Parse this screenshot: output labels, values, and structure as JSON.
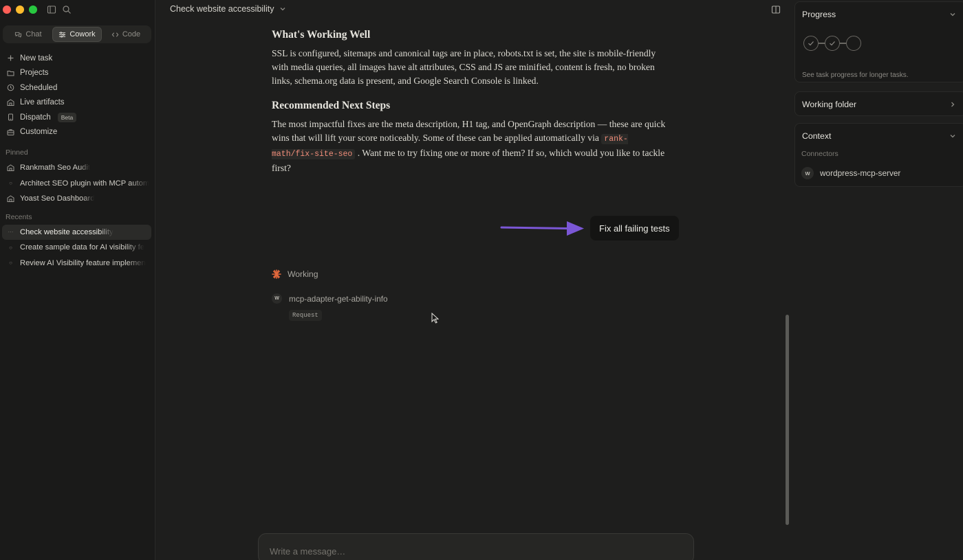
{
  "sidebar": {
    "mode_tabs": [
      {
        "label": "Chat",
        "icon": "chat-bubbles-icon"
      },
      {
        "label": "Cowork",
        "icon": "sliders-icon",
        "active": true
      },
      {
        "label": "Code",
        "icon": "code-brackets-icon"
      }
    ],
    "nav": [
      {
        "label": "New task",
        "icon": "plus-icon"
      },
      {
        "label": "Projects",
        "icon": "folder-icon"
      },
      {
        "label": "Scheduled",
        "icon": "clock-icon"
      },
      {
        "label": "Live artifacts",
        "icon": "artifact-icon"
      },
      {
        "label": "Dispatch",
        "icon": "phone-icon",
        "badge": "Beta"
      },
      {
        "label": "Customize",
        "icon": "briefcase-icon"
      }
    ],
    "pinned_label": "Pinned",
    "pinned": [
      {
        "label": "Rankmath Seo Audit",
        "icon": "artifact-icon"
      },
      {
        "label": "Architect SEO plugin with MCP autom",
        "icon": "circle-icon"
      },
      {
        "label": "Yoast Seo Dashboard",
        "icon": "artifact-icon"
      }
    ],
    "recents_label": "Recents",
    "recents": [
      {
        "label": "Check website accessibility",
        "icon": "ellipsis-icon",
        "active": true
      },
      {
        "label": "Create sample data for AI visibility fe",
        "icon": "circle-icon"
      },
      {
        "label": "Review AI Visibility feature implemen",
        "icon": "circle-icon"
      }
    ]
  },
  "header": {
    "title": "Check website accessibility"
  },
  "content": {
    "section1_heading": "What's Working Well",
    "section1_text": "SSL is configured, sitemaps and canonical tags are in place, robots.txt is set, the site is mobile-friendly with media queries, all images have alt attributes, CSS and JS are minified, content is fresh, no broken links, schema.org data is present, and Google Search Console is linked.",
    "section2_heading": "Recommended Next Steps",
    "section2_text_before": "The most impactful fixes are the meta description, H1 tag, and OpenGraph description — these are quick wins that will lift your score noticeably. Some of these can be applied automatically via ",
    "section2_code": "rank-math/fix-site-seo",
    "section2_text_after": " . Want me to try fixing one or more of them? If so, which would you like to tackle first?"
  },
  "user_message": "Fix all failing tests",
  "status": {
    "working_label": "Working",
    "tool_name": "mcp-adapter-get-ability-info",
    "tool_icon_letter": "W",
    "tool_chip": "Request"
  },
  "composer": {
    "placeholder": "Write a message…"
  },
  "right_panel": {
    "progress_title": "Progress",
    "progress_hint": "See task progress for longer tasks.",
    "working_folder_title": "Working folder",
    "context_title": "Context",
    "connectors_label": "Connectors",
    "connector_name": "wordpress-mcp-server",
    "connector_icon_letter": "W"
  },
  "colors": {
    "accent_arrow": "#7b57d6",
    "code_text": "#f08d7a",
    "working_spinner": "#e2683c"
  }
}
